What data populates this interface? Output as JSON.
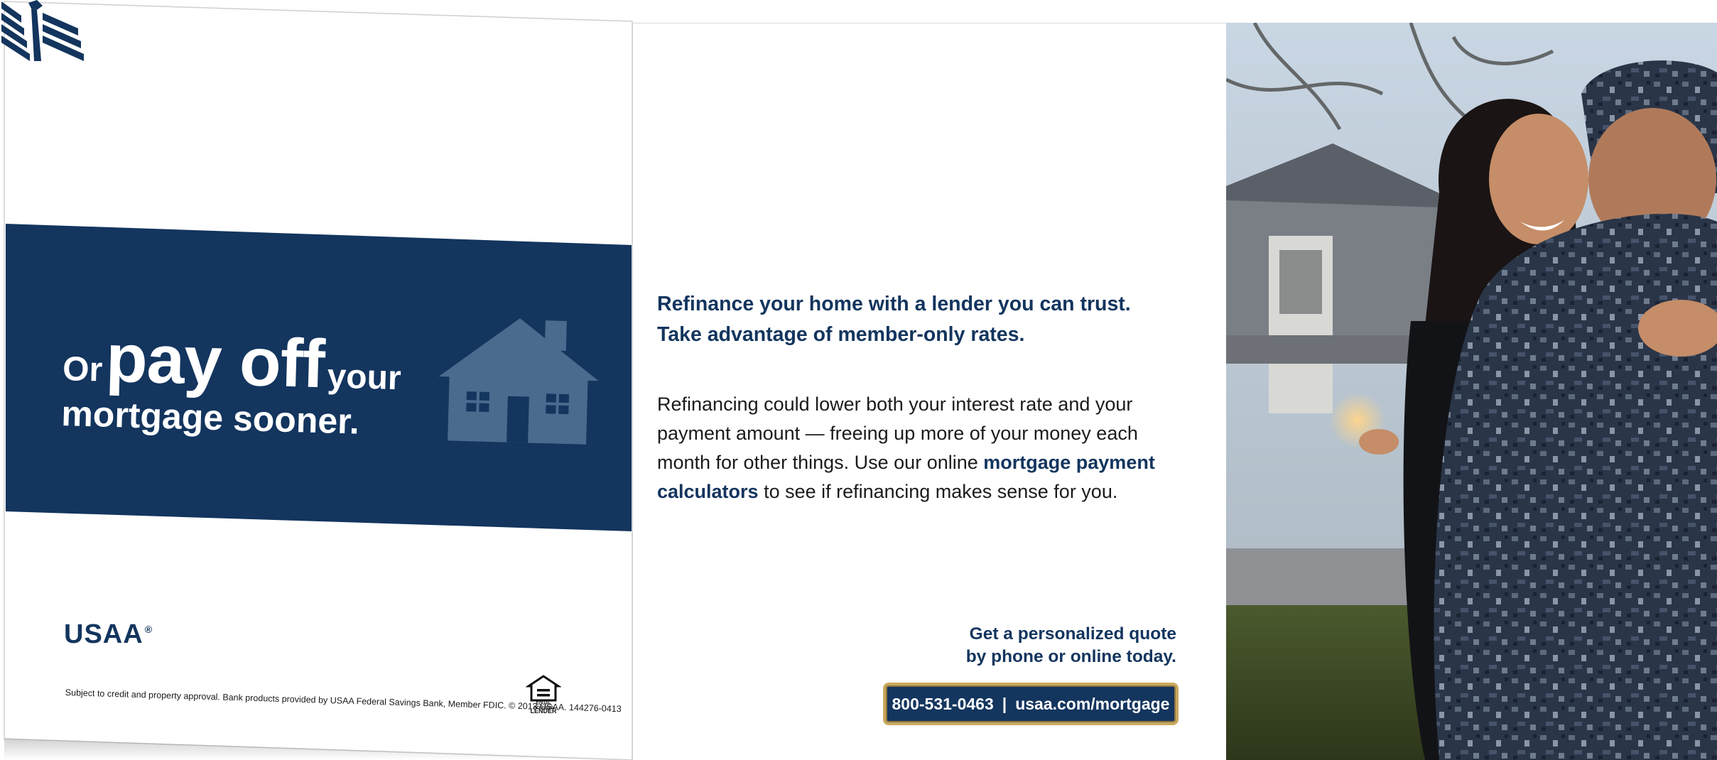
{
  "left": {
    "headline": {
      "or": "Or",
      "pay_off": "pay off",
      "your": "your",
      "line2": "mortgage sooner."
    },
    "logo": {
      "brand": "USAA",
      "registered": "®"
    },
    "disclaimer": "Subject to credit and property approval. Bank products provided by USAA Federal Savings Bank, Member FDIC. © 2013 USAA.  144276-0413",
    "eho": {
      "line1": "EQUAL HOUSING",
      "line2": "LENDER"
    }
  },
  "middle": {
    "heading_line1": "Refinance your home with a lender you can trust.",
    "heading_line2": "Take advantage of member-only rates.",
    "body_part1": "Refinancing could lower both your interest rate and your payment amount — freeing up more of your money each month for other things. Use our online ",
    "body_link": "mortgage payment calculators",
    "body_part2": " to see if refinancing makes sense for you.",
    "cta_line1": "Get a personalized quote",
    "cta_line2": "by phone or online today.",
    "phone": "800-531-0463",
    "separator": "|",
    "url": "usaa.com/mortgage"
  },
  "colors": {
    "brand_navy": "#13355e",
    "house_icon": "#4a6a8e",
    "gold_border": "#c9a95e"
  },
  "icons": [
    "house-icon",
    "usaa-eagle-icon",
    "equal-housing-icon"
  ]
}
